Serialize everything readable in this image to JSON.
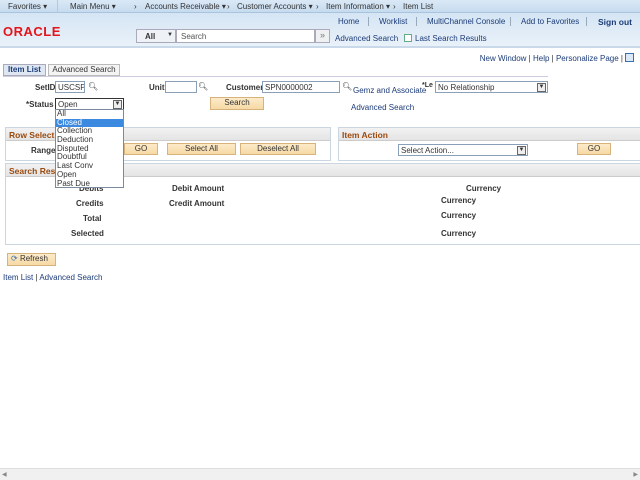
{
  "nav": {
    "favorites": "Favorites ▾",
    "main_menu": "Main Menu ▾",
    "crumbs": [
      "Accounts Receivable ▾",
      "Customer Accounts ▾",
      "Item Information ▾",
      "Item List"
    ]
  },
  "header": {
    "logo": "ORACLE",
    "links": [
      "Home",
      "Worklist",
      "MultiChannel Console",
      "Add to Favorites",
      "Sign out"
    ],
    "search_scope": "All",
    "search_placeholder": "Search",
    "advanced_search": "Advanced Search",
    "last_results": "Last Search Results"
  },
  "pagebar": {
    "new_window": "New Window",
    "help": "Help",
    "personalize": "Personalize Page"
  },
  "tabs": [
    {
      "label": "Item List",
      "active": true
    },
    {
      "label": "Advanced Search",
      "active": false
    }
  ],
  "form": {
    "setid_label": "SetID",
    "setid": "USCSP",
    "unit_label": "Unit",
    "unit": "",
    "customer_label": "Customer",
    "customer": "SPN0000002",
    "customer_name": "Gemz and Associate",
    "level_label": "*Le",
    "level": "No Relationship",
    "status_label": "*Status",
    "status": "Open",
    "search_btn": "Search",
    "advanced_search": "Advanced Search"
  },
  "status_options": [
    "All",
    "Closed",
    "Collection",
    "Deduction",
    "Disputed",
    "Doubtful",
    "Last Conv",
    "Open",
    "Past Due"
  ],
  "status_highlighted": "Closed",
  "row_select": {
    "title": "Row Select",
    "range_label": "Range",
    "go": "GO",
    "select_all": "Select All",
    "deselect_all": "Deselect All"
  },
  "item_action": {
    "title": "Item Action",
    "select": "Select Action...",
    "go": "GO"
  },
  "results": {
    "title": "Search Res",
    "debits": "Debits",
    "debit_amount": "Debit Amount",
    "credits": "Credits",
    "credit_amount": "Credit Amount",
    "total": "Total",
    "selected": "Selected",
    "currency": "Currency"
  },
  "refresh": "Refresh",
  "footer": {
    "item_list": "Item List",
    "sep": "|",
    "advanced_search": "Advanced Search"
  }
}
